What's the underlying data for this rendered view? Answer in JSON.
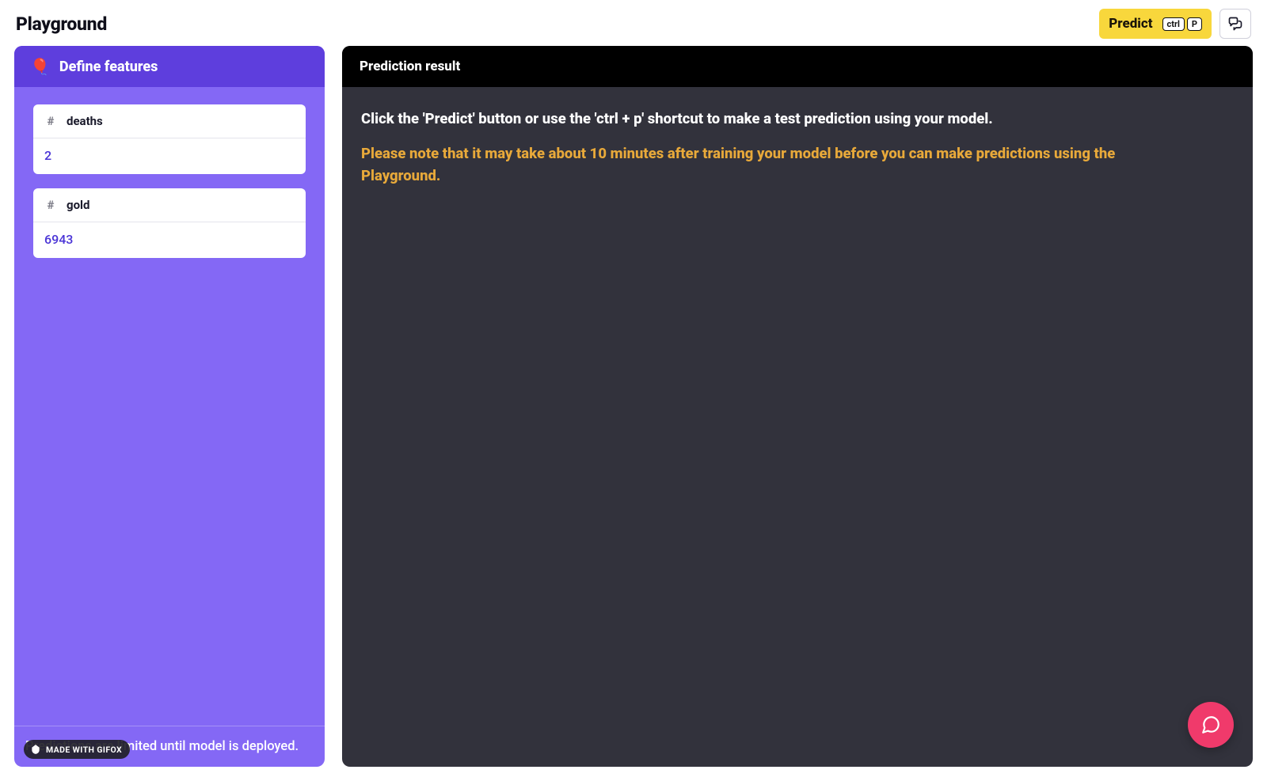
{
  "header": {
    "title": "Playground",
    "predict_label": "Predict",
    "shortcut_key1": "ctrl",
    "shortcut_key2": "P"
  },
  "leftPanel": {
    "icon": "🎈",
    "title": "Define features",
    "footer_note": "Predictions are limited until model is deployed.",
    "gifox_label": "MADE WITH GIFOX",
    "features": [
      {
        "type_icon": "#",
        "name": "deaths",
        "value": "2"
      },
      {
        "type_icon": "#",
        "name": "gold",
        "value": "6943"
      }
    ]
  },
  "rightPanel": {
    "title": "Prediction result",
    "instruction": "Click the 'Predict' button or use the 'ctrl + p' shortcut to make a test prediction using your model.",
    "warning": "Please note that it may take about 10 minutes after training your model before you can make predictions using the Playground."
  }
}
